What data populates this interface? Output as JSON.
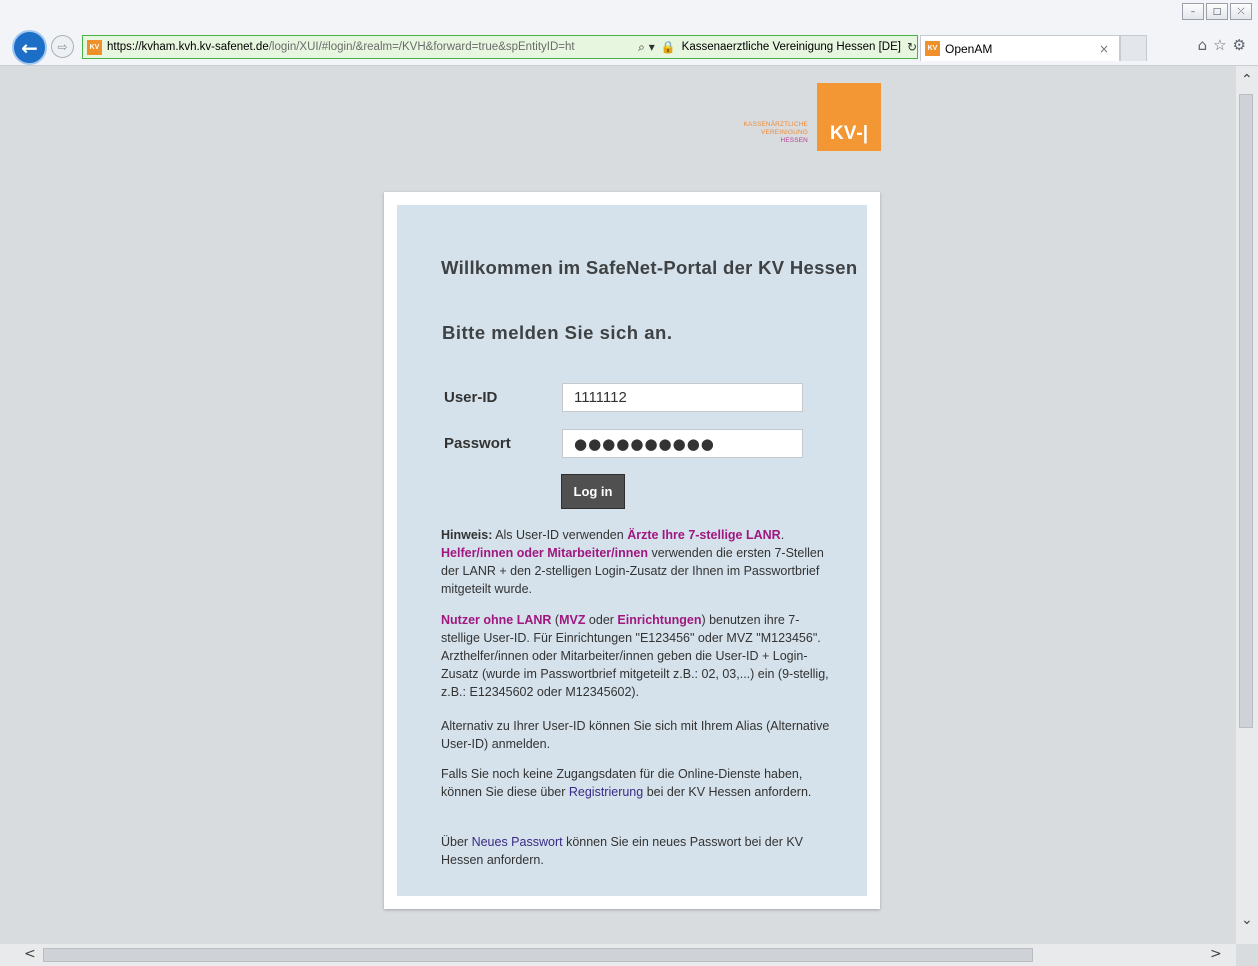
{
  "browser": {
    "window_controls": {
      "minimize": "–",
      "maximize": "□",
      "close": "⤫"
    },
    "back_glyph": "←",
    "forward_glyph": "⇨",
    "favicon_text": "KV",
    "url_host": "https://kvham.kvh.kv-safenet.de",
    "url_path": "/login/XUI/#login/&realm=/KVH&forward=true&spEntityID=ht",
    "search_glyph": "⌕ ▾",
    "lock_glyph": "🔒",
    "site_identity": "Kassenaerztliche Vereinigung Hessen [DE]",
    "refresh_glyph": "↻",
    "tab_title": "OpenAM",
    "tab_close": "×",
    "toolbar_icons": {
      "home": "⌂",
      "favorites": "☆",
      "settings": "⚙"
    }
  },
  "logo": {
    "line1": "KASSENÄRZTLICHE",
    "line2": "VEREINIGUNG",
    "line3": "HESSEN",
    "mark": "KV‐|",
    "colors": {
      "orange": "#f29733",
      "magenta": "#b3418f"
    }
  },
  "login": {
    "welcome": "Willkommen im SafeNet-Portal der KV Hessen",
    "prompt": "Bitte melden Sie sich an.",
    "userid_label": "User-ID",
    "userid_value": "1111112",
    "password_label": "Passwort",
    "password_value": "●●●●●●●●●●",
    "login_button": "Log in"
  },
  "info": {
    "p1": {
      "hint": "Hinweis:",
      "t1": " Als User-ID verwenden ",
      "l1": "Ärzte Ihre 7-stellige LANR",
      "t2": ". ",
      "l2": "Helfer/innen oder Mitarbeiter/innen",
      "t3": " verwenden die ersten 7-Stellen der LANR + den 2-stelligen Login-Zusatz der Ihnen im Passwortbrief mitgeteilt wurde."
    },
    "p2": {
      "l1": "Nutzer ohne LANR",
      "t1": " (",
      "l2": "MVZ",
      "t2": " oder ",
      "l3": "Einrichtungen",
      "t3": ") benutzen ihre 7-stellige User-ID. Für Einrichtungen \"E123456\" oder MVZ \"M123456\". Arzthelfer/innen oder Mitarbeiter/innen geben die User-ID + Login-Zusatz (wurde im Passwortbrief mitgeteilt z.B.: 02, 03,...) ein (9-stellig, z.B.: E12345602 oder M12345602)."
    },
    "p3": "Alternativ zu Ihrer User-ID können Sie sich mit Ihrem Alias (Alternative User-ID) anmelden.",
    "p4": {
      "t1": "Falls Sie noch keine Zugangsdaten für die Online-Dienste haben, können Sie diese über ",
      "link": "Registrierung",
      "t2": " bei der KV Hessen anfordern."
    },
    "p5": {
      "t1": "Über ",
      "link": "Neues Passwort",
      "t2": " können Sie ein neues Passwort bei der KV Hessen anfordern."
    }
  },
  "scrollbars": {
    "up": "⌃",
    "down": "⌄",
    "left": "<",
    "right": ">"
  }
}
